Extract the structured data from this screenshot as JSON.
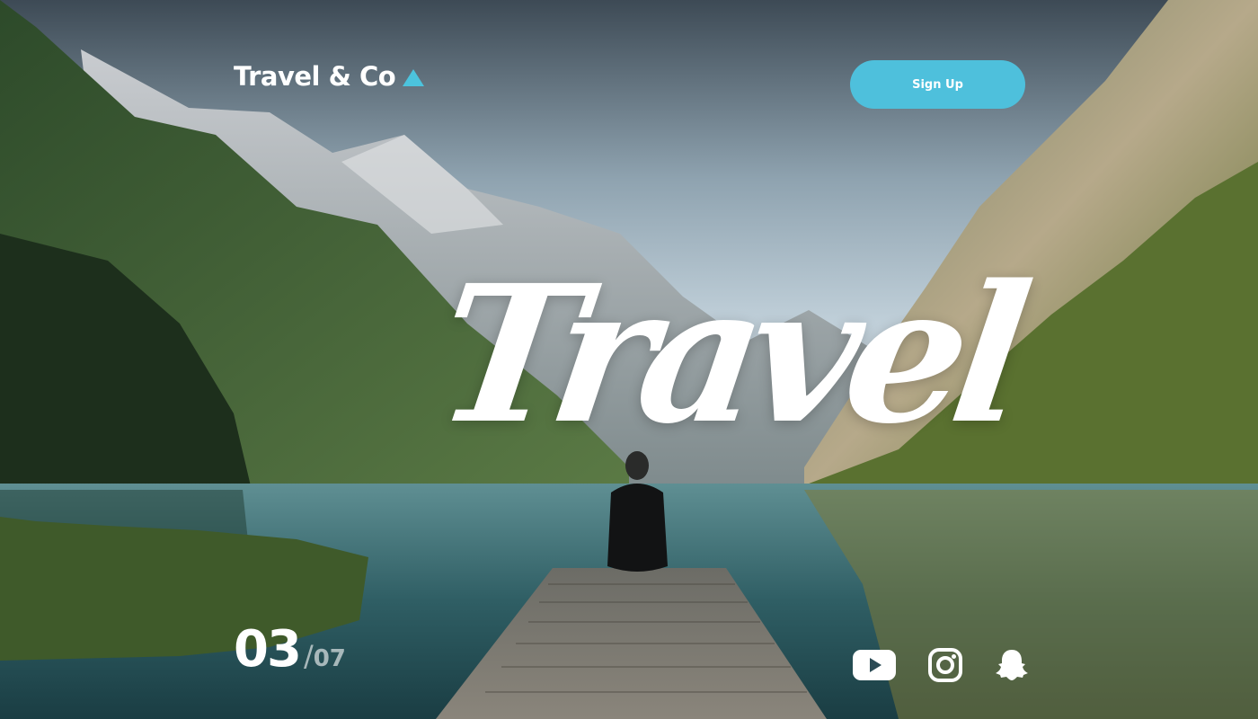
{
  "header": {
    "brand": "Travel & Co",
    "signup_label": "Sign Up"
  },
  "hero": {
    "title": "Travel"
  },
  "pagination": {
    "current": "03",
    "separator": "/",
    "total": "07"
  },
  "social": {
    "icons": [
      "youtube-icon",
      "instagram-icon",
      "snapchat-icon"
    ]
  },
  "colors": {
    "accent": "#4ec0dc",
    "text": "#ffffff"
  }
}
